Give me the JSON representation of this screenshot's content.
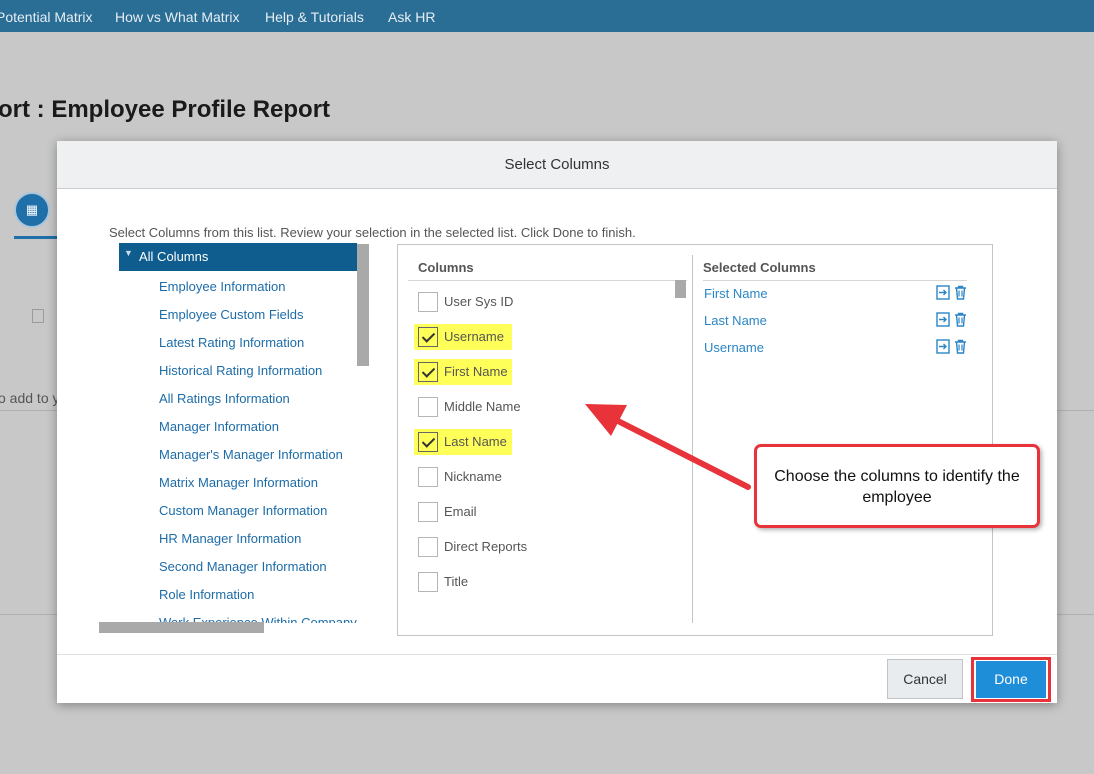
{
  "nav": {
    "items": [
      "Potential Matrix",
      "How vs What Matrix",
      "Help & Tutorials",
      "Ask HR"
    ],
    "bar_color": "#2a6d95"
  },
  "page": {
    "title": "ort : Employee Profile Report",
    "partial_text": "o add to y"
  },
  "modal": {
    "title": "Select Columns",
    "instructions": "Select Columns from this list. Review your selection in the selected list. Click Done to finish.",
    "categories": [
      "All Columns",
      "Employee Information",
      "Employee Custom Fields",
      "Latest Rating Information",
      "Historical Rating Information",
      "All Ratings Information",
      "Manager Information",
      "Manager's Manager Information",
      "Matrix Manager Information",
      "Custom Manager Information",
      "HR Manager Information",
      "Second Manager Information",
      "Role Information",
      "Work Experience Within Company"
    ],
    "columns_header": "Columns",
    "selected_header": "Selected Columns",
    "columns": [
      {
        "label": "User Sys ID",
        "checked": false
      },
      {
        "label": "Username",
        "checked": true
      },
      {
        "label": "First Name",
        "checked": true
      },
      {
        "label": "Middle Name",
        "checked": false
      },
      {
        "label": "Last Name",
        "checked": true
      },
      {
        "label": "Nickname",
        "checked": false
      },
      {
        "label": "Email",
        "checked": false
      },
      {
        "label": "Direct Reports",
        "checked": false
      },
      {
        "label": "Title",
        "checked": false
      }
    ],
    "selected": [
      "First Name",
      "Last Name",
      "Username"
    ],
    "cancel_label": "Cancel",
    "done_label": "Done",
    "callout": "Choose the columns to identify the employee",
    "accent_color": "#1f8ed8",
    "highlight_color": "#ffff5a",
    "annotation_color": "#e8333a"
  }
}
